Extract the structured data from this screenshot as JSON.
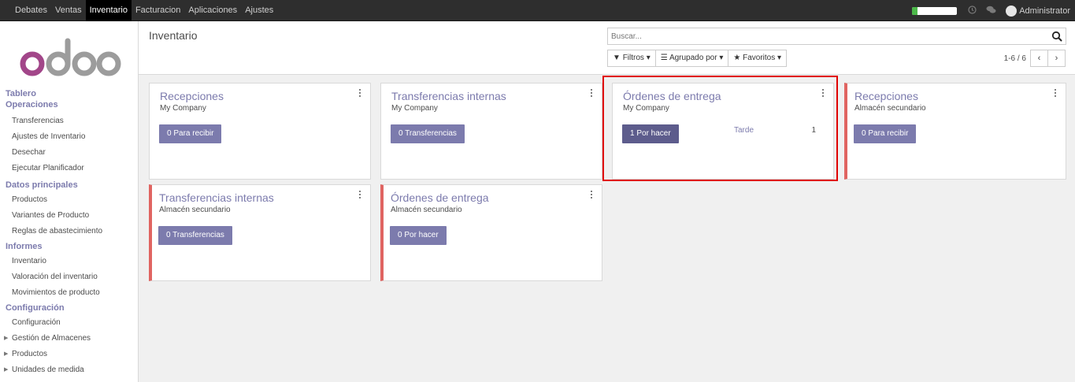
{
  "topbar": {
    "menu": [
      "Debates",
      "Ventas",
      "Inventario",
      "Facturacion",
      "Aplicaciones",
      "Ajustes"
    ],
    "active_index": 2,
    "progress_fraction": 0.12,
    "icons": [
      "clock-icon",
      "chat-icon"
    ],
    "user": "Administrator",
    "colors": {
      "bar": "#2e2e2e",
      "active": "#000000",
      "progress": "#4cb849"
    }
  },
  "sidebar": {
    "logo": "odoo",
    "sections": [
      {
        "heading": "Tablero",
        "items": []
      },
      {
        "heading": "Operaciones",
        "items": [
          "Transferencias",
          "Ajustes de Inventario",
          "Desechar",
          "Ejecutar Planificador"
        ]
      },
      {
        "heading": "Datos principales",
        "items": [
          "Productos",
          "Variantes de Producto",
          "Reglas de abastecimiento"
        ]
      },
      {
        "heading": "Informes",
        "items": [
          "Inventario",
          "Valoración del inventario",
          "Movimientos de producto"
        ]
      },
      {
        "heading": "Configuración",
        "items": [
          "Configuración",
          "Gestión de Almacenes",
          "Productos",
          "Unidades de medida"
        ]
      }
    ]
  },
  "control_panel": {
    "breadcrumb": "Inventario",
    "search_placeholder": "Buscar...",
    "filters": [
      "Filtros",
      "Agrupado por",
      "Favoritos"
    ],
    "pager": "1-6 / 6"
  },
  "cards": [
    {
      "title": "Recepciones",
      "company": "My Company",
      "button": "0 Para recibir",
      "late": false
    },
    {
      "title": "Transferencias internas",
      "company": "My Company",
      "button": "0 Transferencias",
      "late": false
    },
    {
      "title": "Órdenes de entrega",
      "company": "My Company",
      "button": "1 Por hacer",
      "late": false,
      "late_label": "Tarde",
      "late_count": "1",
      "highlighted": true
    },
    {
      "title": "Recepciones",
      "company": "Almacén secundario",
      "button": "0 Para recibir",
      "late": true
    },
    {
      "title": "Transferencias internas",
      "company": "Almacén secundario",
      "button": "0 Transferencias",
      "late": true
    },
    {
      "title": "Órdenes de entrega",
      "company": "Almacén secundario",
      "button": "0 Por hacer",
      "late": true
    }
  ],
  "colors": {
    "accent": "#7c7bad",
    "warning_border": "#e06461",
    "highlight": "#e00000"
  }
}
